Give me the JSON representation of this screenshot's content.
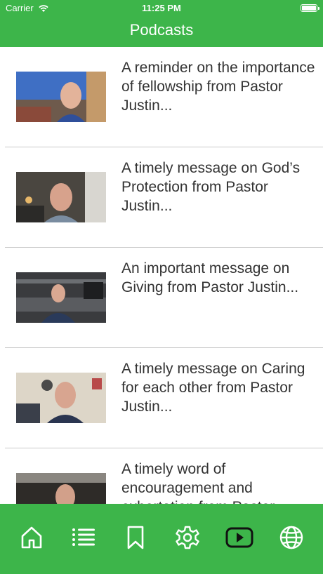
{
  "status_bar": {
    "carrier": "Carrier",
    "time": "11:25 PM"
  },
  "nav": {
    "title": "Podcasts"
  },
  "podcasts": [
    {
      "title": "A reminder on the importance of fellowship from Pastor Justin..."
    },
    {
      "title": "A timely message on God’s Protection from Pastor Justin..."
    },
    {
      "title": "An important message on Giving from Pastor Justin..."
    },
    {
      "title": "A timely message on Caring for each other from Pastor Justin..."
    },
    {
      "title": "A timely word of encouragement and exhortation from Pastor Justin..."
    }
  ],
  "tabbar": {
    "items": [
      {
        "icon": "home-icon"
      },
      {
        "icon": "list-icon"
      },
      {
        "icon": "bookmark-icon"
      },
      {
        "icon": "gear-icon"
      },
      {
        "icon": "youtube-icon"
      },
      {
        "icon": "globe-icon"
      }
    ]
  },
  "colors": {
    "accent": "#3db54a",
    "text": "#333333",
    "separator": "#c8c8c8"
  }
}
